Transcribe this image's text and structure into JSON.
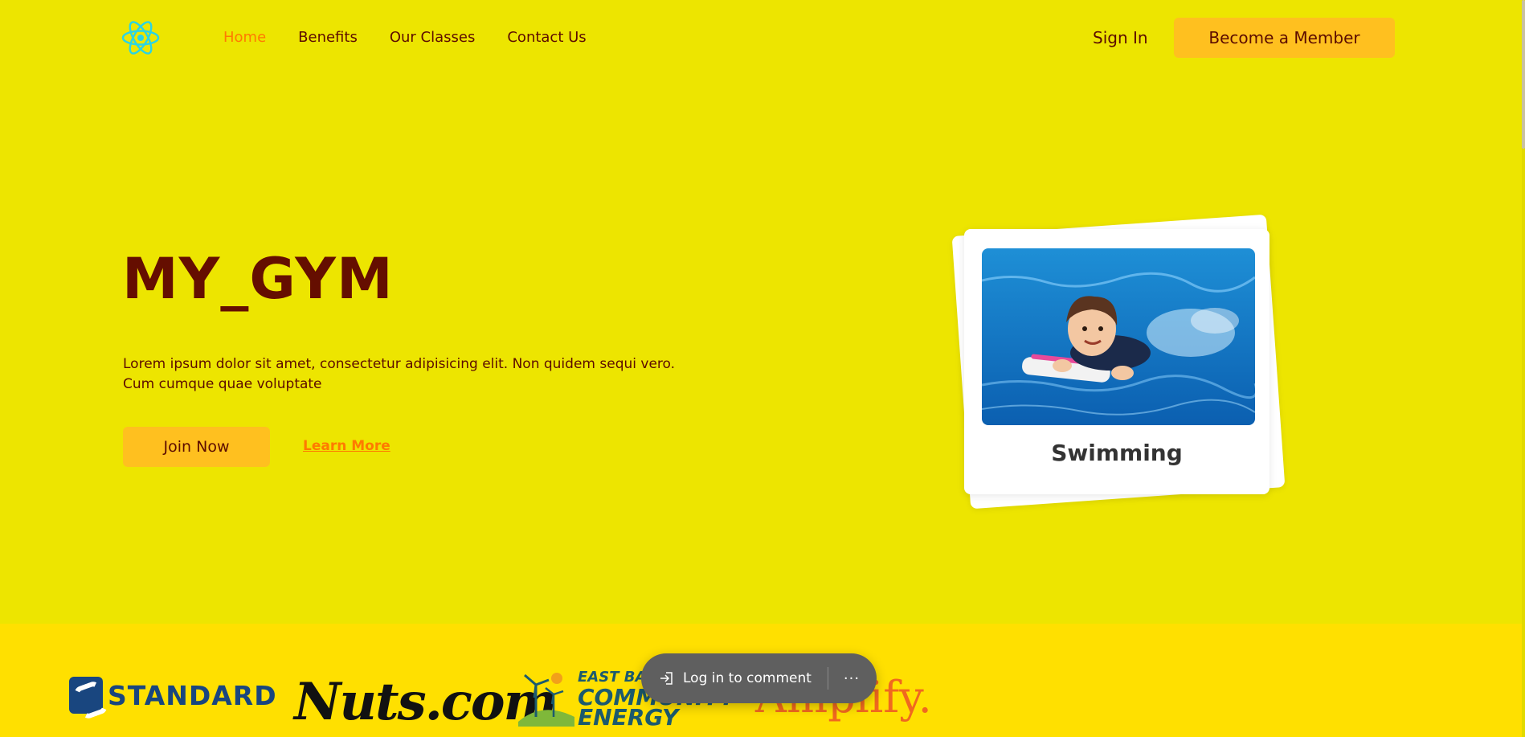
{
  "nav": {
    "links": [
      {
        "label": "Home",
        "active": true
      },
      {
        "label": "Benefits",
        "active": false
      },
      {
        "label": "Our Classes",
        "active": false
      },
      {
        "label": "Contact Us",
        "active": false
      }
    ],
    "sign_in": "Sign In",
    "cta": "Become a Member",
    "logo_icon": "react-atom-icon"
  },
  "hero": {
    "title": "MY_GYM",
    "description": "Lorem ipsum dolor sit amet, consectetur adipisicing elit. Non quidem sequi vero. Cum cumque quae voluptate",
    "primary_button": "Join Now",
    "secondary_link": "Learn More"
  },
  "card": {
    "label": "Swimming"
  },
  "brands": {
    "standard": "STANDARD",
    "nuts": "Nuts.com",
    "eastbay": {
      "line1": "EAST BAY",
      "line2": "COMMUNITY",
      "line3": "ENERGY"
    },
    "amplify": "Amplify."
  },
  "toast": {
    "login": "Log in to comment",
    "more": "···"
  },
  "colors": {
    "background": "#ede500",
    "brand_strip": "#ffe000",
    "accent": "#ffc01f",
    "active_link": "#ff7a00",
    "text": "#5c0c00"
  }
}
